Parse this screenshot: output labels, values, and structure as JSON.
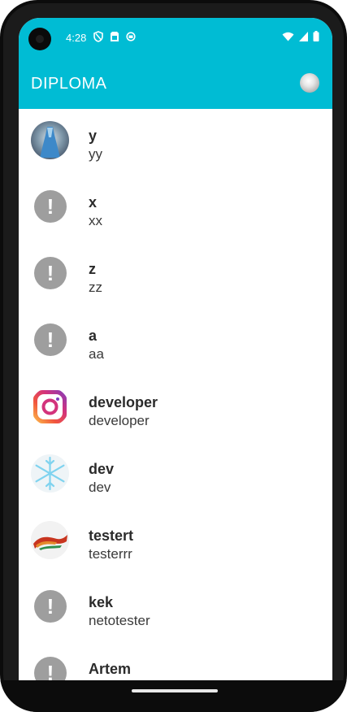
{
  "status_bar": {
    "time": "4:28",
    "left_icons": [
      "shield-icon",
      "sim-card-icon",
      "sync-icon"
    ],
    "right_icons": [
      "wifi-icon",
      "signal-icon",
      "battery-icon"
    ]
  },
  "app_bar": {
    "title": "DIPLOMA",
    "avatar_icon": "profile-avatar"
  },
  "colors": {
    "primary": "#00bcd4",
    "alert_gray": "#9e9e9e"
  },
  "items": [
    {
      "name": "y",
      "subtitle": "yy",
      "avatar": "dress-photo"
    },
    {
      "name": "x",
      "subtitle": "xx",
      "avatar": "alert-icon"
    },
    {
      "name": "z",
      "subtitle": "zz",
      "avatar": "alert-icon"
    },
    {
      "name": "a",
      "subtitle": "aa",
      "avatar": "alert-icon"
    },
    {
      "name": "developer",
      "subtitle": "developer",
      "avatar": "instagram-logo"
    },
    {
      "name": "dev",
      "subtitle": "dev",
      "avatar": "snowflake-image"
    },
    {
      "name": "testert",
      "subtitle": "testerrr",
      "avatar": "ribbon-image"
    },
    {
      "name": "kek",
      "subtitle": "netotester",
      "avatar": "alert-icon"
    },
    {
      "name": "Artem",
      "subtitle": "",
      "avatar": "alert-icon"
    }
  ]
}
